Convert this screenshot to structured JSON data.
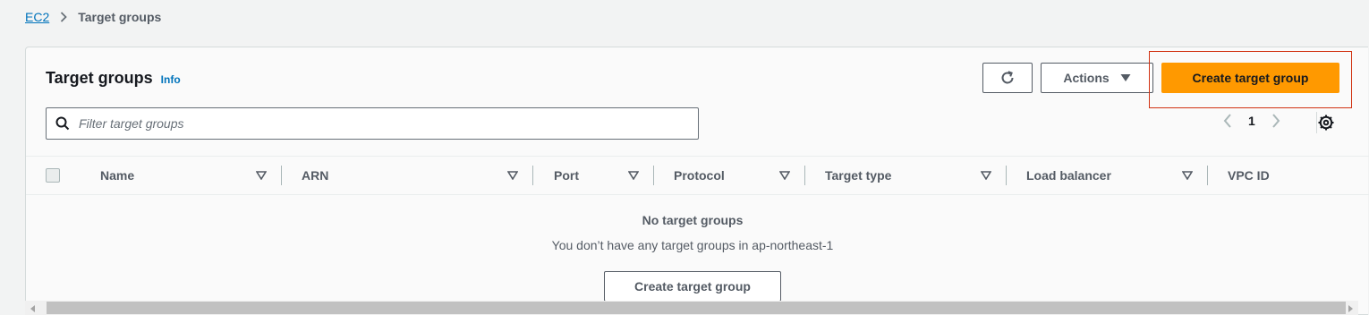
{
  "breadcrumb": {
    "root_label": "EC2",
    "separator_icon": "chevron-right-icon",
    "current_label": "Target groups"
  },
  "panel": {
    "title": "Target groups",
    "info_label": "Info",
    "actions_label": "Actions",
    "create_label": "Create target group",
    "refresh_icon": "refresh-icon",
    "settings_icon": "gear-icon"
  },
  "filter": {
    "placeholder": "Filter target groups",
    "value": ""
  },
  "pagination": {
    "current_page": "1"
  },
  "table": {
    "columns": [
      {
        "label": "Name"
      },
      {
        "label": "ARN"
      },
      {
        "label": "Port"
      },
      {
        "label": "Protocol"
      },
      {
        "label": "Target type"
      },
      {
        "label": "Load balancer"
      },
      {
        "label": "VPC ID"
      }
    ],
    "rows": []
  },
  "empty_state": {
    "title": "No target groups",
    "description": "You don’t have any target groups in ap-northeast-1",
    "button_label": "Create target group"
  },
  "colors": {
    "primary_button": "#ff9900",
    "link": "#0073bb",
    "highlight": "#d13212"
  }
}
